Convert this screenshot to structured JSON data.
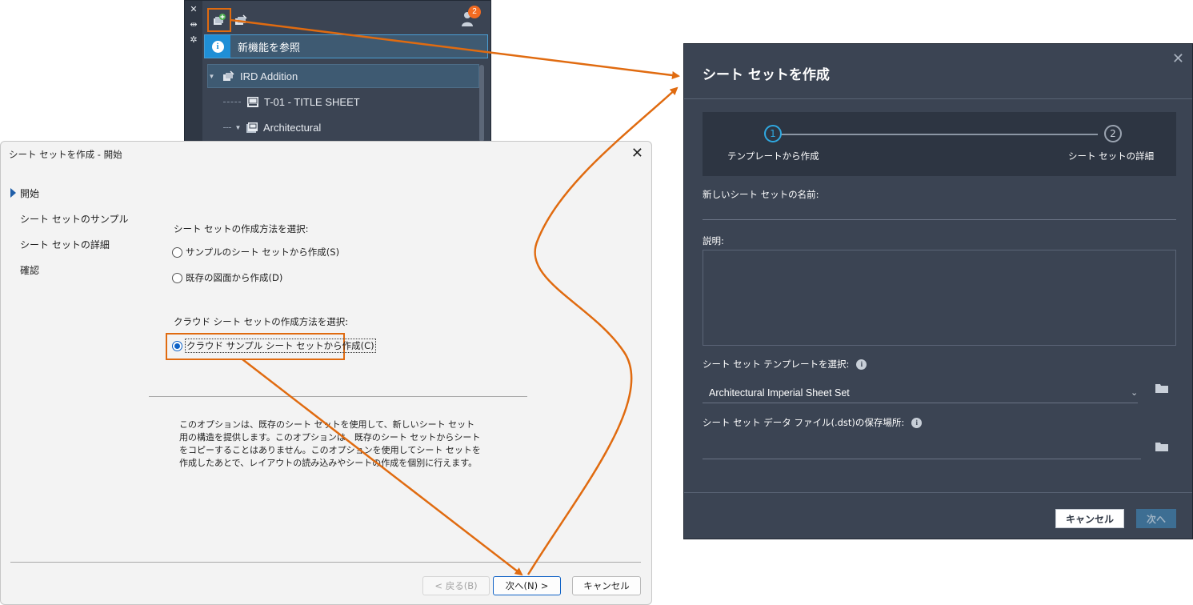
{
  "palette": {
    "info_text": "新機能を参照",
    "badge_count": "2",
    "tree": [
      {
        "label": "IRD Addition"
      },
      {
        "label": "T-01 - TITLE SHEET"
      },
      {
        "label": "Architectural"
      }
    ]
  },
  "wizard": {
    "title": "シート セットを作成 - 開始",
    "close": "✕",
    "nav": [
      "開始",
      "シート セットのサンプル",
      "シート セットの詳細",
      "確認"
    ],
    "method_label": "シート セットの作成方法を選択:",
    "option_sample": "サンプルのシート セットから作成(S)",
    "option_existing": "既存の図面から作成(D)",
    "cloud_label": "クラウド シート セットの作成方法を選択:",
    "option_cloud": "クラウド サンプル シート セットから作成(C)",
    "description": "このオプションは、既存のシート セットを使用して、新しいシート セット用の構造を提供します。このオプションは、既存のシート セットからシートをコピーすることはありません。このオプションを使用してシート セットを作成したあとで、レイアウトの読み込みやシートの作成を個別に行えます。",
    "back_button": "< 戻る(B)",
    "next_button": "次へ(N) >",
    "cancel_button": "キャンセル"
  },
  "new_dialog": {
    "title": "シート セットを作成",
    "close": "✕",
    "step1_number": "1",
    "step1_label": "テンプレートから作成",
    "step2_number": "2",
    "step2_label": "シート セットの詳細",
    "name_label": "新しいシート セットの名前:",
    "description_label": "説明:",
    "template_label": "シート セット テンプレートを選択:",
    "template_value": "Architectural Imperial Sheet Set",
    "location_label": "シート セット データ ファイル(.dst)の保存場所:",
    "cancel_button": "キャンセル",
    "next_button": "次へ"
  },
  "colors": {
    "highlight": "#e06b10",
    "dark_panel": "#3b4453",
    "accent_blue": "#2fa8e0"
  }
}
